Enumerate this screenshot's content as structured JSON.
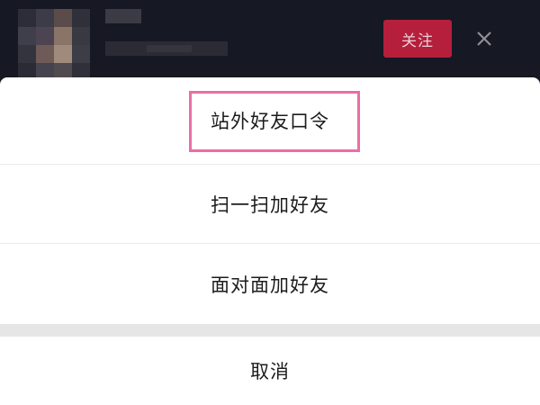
{
  "header": {
    "follow_label": "关注",
    "avatar_pixels": [
      "#2c2d38",
      "#3b3c48",
      "#5b4c4b",
      "#2f3039",
      "#3e3f4b",
      "#4d4451",
      "#8a7468",
      "#383942",
      "#33343e",
      "#6e5b57",
      "#a08a7c",
      "#3c3d46",
      "#2a2b35",
      "#45434d",
      "#514a4f",
      "#2f303a"
    ]
  },
  "sheet": {
    "items": [
      {
        "label": "站外好友口令",
        "highlighted": true
      },
      {
        "label": "扫一扫加好友"
      },
      {
        "label": "面对面加好友"
      }
    ],
    "cancel_label": "取消"
  },
  "colors": {
    "header_bg": "#161823",
    "follow_bg": "#b51f3c",
    "highlight_border": "#ea6ea6"
  }
}
